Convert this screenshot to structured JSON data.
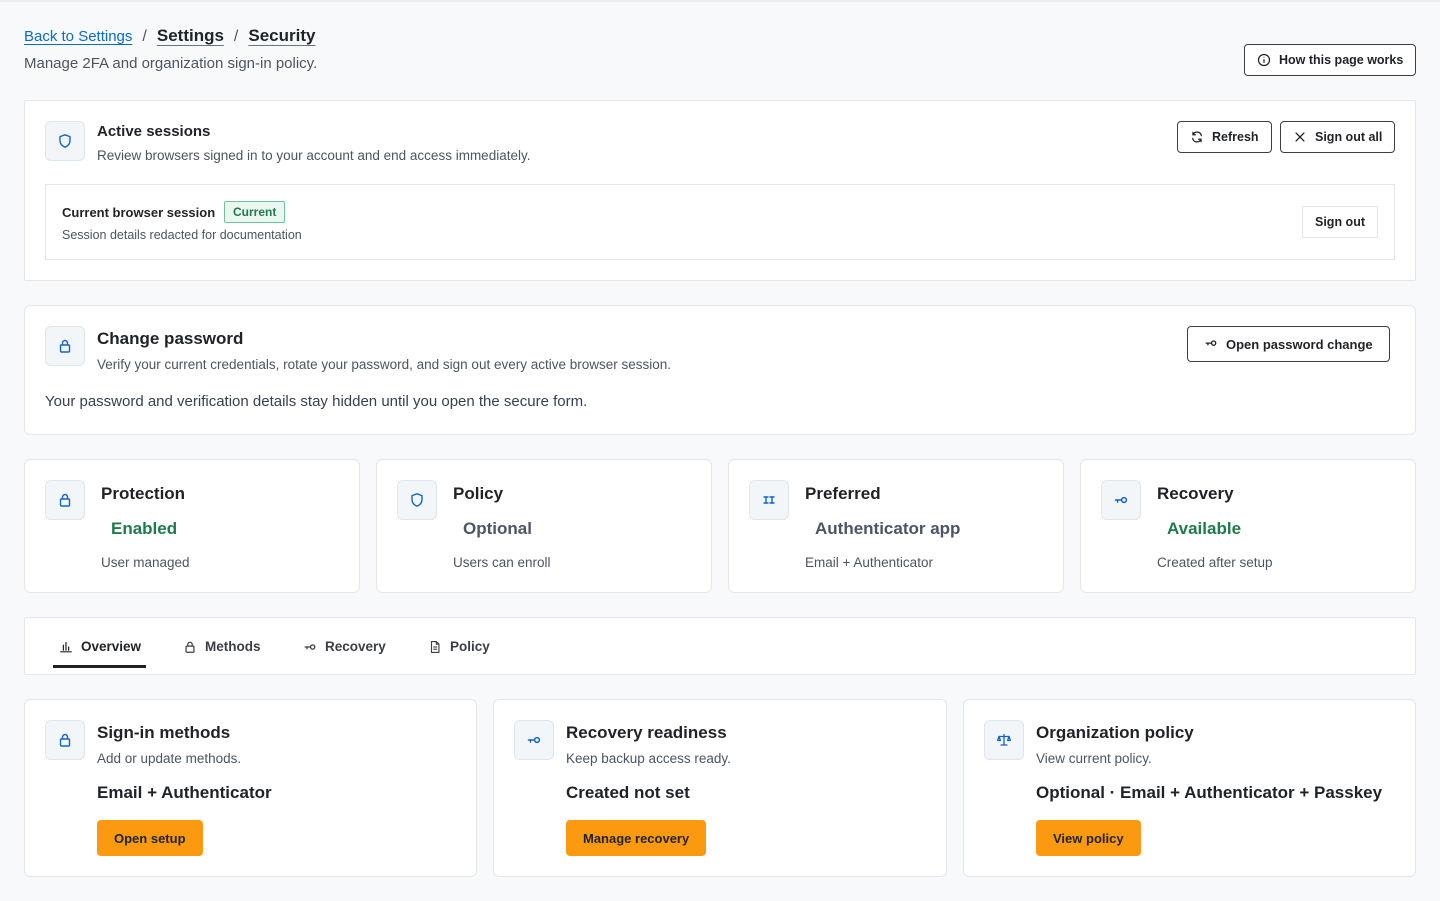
{
  "breadcrumb": {
    "back": "Back to Settings",
    "sep": "/",
    "settings": "Settings",
    "current": "Security"
  },
  "subtitle": "Manage 2FA and organization sign-in policy.",
  "help_button": "How this page works",
  "sessions": {
    "title": "Active sessions",
    "description": "Review browsers signed in to your account and end access immediately.",
    "refresh": "Refresh",
    "sign_out_all": "Sign out all",
    "current": {
      "name": "Current browser session",
      "badge": "Current",
      "meta": "Session details redacted for documentation",
      "sign_out": "Sign out"
    }
  },
  "password": {
    "title": "Change password",
    "description": "Verify your current credentials, rotate your password, and sign out every active browser session.",
    "button": "Open password change",
    "note": "Your password and verification details stay hidden until you open the secure form."
  },
  "stats": [
    {
      "label": "Protection",
      "value": "Enabled",
      "meta": "User managed",
      "icon": "lock-icon",
      "color": "#1f7a4d"
    },
    {
      "label": "Policy",
      "value": "Optional",
      "meta": "Users can enroll",
      "icon": "shield-icon",
      "color": "#4b5563"
    },
    {
      "label": "Preferred",
      "value": "Authenticator app",
      "meta": "Email + Authenticator",
      "icon": "authenticator-icon",
      "color": "#4b5563"
    },
    {
      "label": "Recovery",
      "value": "Available",
      "meta": "Created after setup",
      "icon": "key-icon",
      "color": "#1f7a4d"
    }
  ],
  "tabs": [
    {
      "label": "Overview",
      "icon": "chart-icon",
      "active": true
    },
    {
      "label": "Methods",
      "icon": "lock-icon"
    },
    {
      "label": "Recovery",
      "icon": "key-icon"
    },
    {
      "label": "Policy",
      "icon": "document-icon"
    }
  ],
  "overview_cards": [
    {
      "title": "Sign-in methods",
      "description": "Add or update methods.",
      "value": "Email + Authenticator",
      "button": "Open setup",
      "icon": "lock-icon"
    },
    {
      "title": "Recovery readiness",
      "description": "Keep backup access ready.",
      "value": "Created not set",
      "button": "Manage recovery",
      "icon": "key-icon"
    },
    {
      "title": "Organization policy",
      "description": "View current policy.",
      "value": "Optional · Email + Authenticator + Passkey",
      "button": "View policy",
      "icon": "scale-icon"
    }
  ],
  "colors": {
    "accent_orange": "#fb9a0e",
    "link_blue": "#0b6bcb",
    "success_green": "#1f7a4d",
    "icon_blue": "#1565c0"
  }
}
